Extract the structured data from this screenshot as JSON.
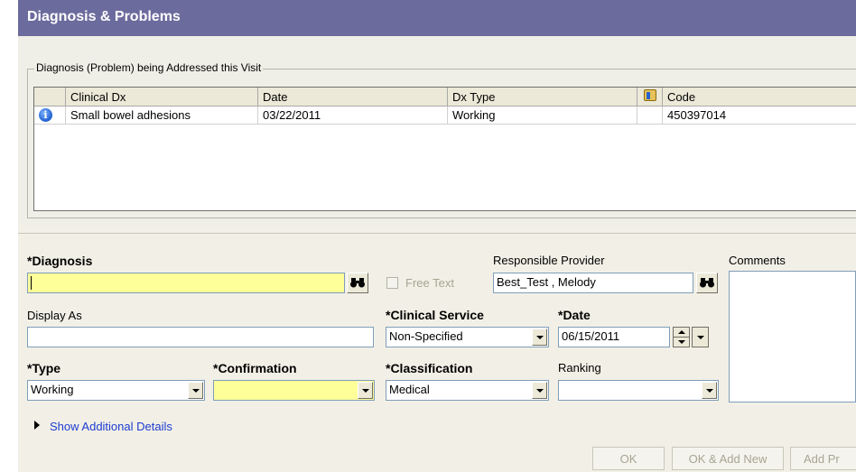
{
  "window": {
    "title": "Diagnosis & Problems"
  },
  "visit_group": {
    "legend": "Diagnosis (Problem) being Addressed this Visit",
    "columns": [
      "Clinical Dx",
      "Date",
      "Dx Type",
      "",
      "Code"
    ],
    "rows": [
      {
        "clinical_dx": "Small bowel adhesions",
        "date": "03/22/2011",
        "dx_type": "Working",
        "code": "450397014"
      }
    ]
  },
  "form": {
    "diagnosis": {
      "label": "*Diagnosis",
      "value": ""
    },
    "free_text": {
      "label": "Free Text",
      "checked": false
    },
    "responsible_provider": {
      "label": "Responsible Provider",
      "value": "Best_Test , Melody"
    },
    "comments": {
      "label": "Comments",
      "value": ""
    },
    "display_as": {
      "label": "Display As",
      "value": ""
    },
    "clinical_service": {
      "label": "*Clinical Service",
      "value": "Non-Specified"
    },
    "date": {
      "label": "*Date",
      "value": "06/15/2011"
    },
    "type": {
      "label": "*Type",
      "value": "Working"
    },
    "confirmation": {
      "label": "*Confirmation",
      "value": ""
    },
    "classification": {
      "label": "*Classification",
      "value": "Medical"
    },
    "ranking": {
      "label": "Ranking",
      "value": ""
    },
    "show_additional": "Show Additional Details"
  },
  "buttons": {
    "ok": "OK",
    "ok_add_new": "OK & Add New",
    "add_pr": "Add Pr"
  },
  "colors": {
    "header_bg": "#6c6b9d",
    "required_field": "#ffff99",
    "link": "#1d3bd1"
  }
}
